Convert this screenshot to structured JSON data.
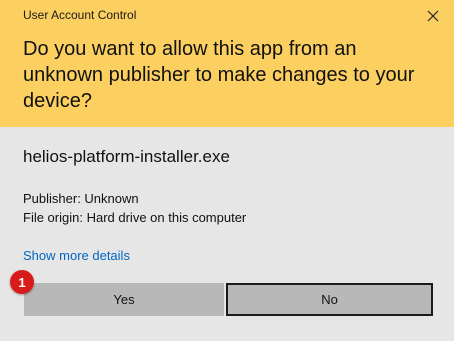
{
  "window": {
    "title": "User Account Control",
    "close_icon": "close-icon"
  },
  "prompt": {
    "question": "Do you want to allow this app from an unknown publisher to make changes to your device?"
  },
  "app": {
    "name": "helios-platform-installer.exe",
    "publisher": "Publisher: Unknown",
    "file_origin": "File origin: Hard drive on this computer"
  },
  "details_link": "Show more details",
  "buttons": {
    "yes_label": "Yes",
    "no_label": "No"
  },
  "annotation": {
    "step_number": "1"
  },
  "colors": {
    "header_background": "#fcd060",
    "body_background": "#e6e6e6",
    "link": "#0067c0",
    "button_background": "#b8b8b8",
    "badge": "#d81b1b"
  }
}
